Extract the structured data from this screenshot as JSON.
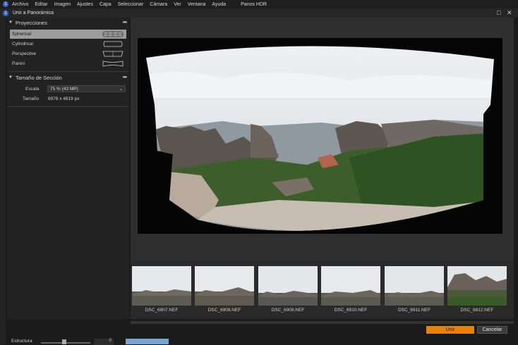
{
  "menubar": {
    "items": [
      "Archivo",
      "Editar",
      "Imagen",
      "Ajustes",
      "Capa",
      "Seleccionar",
      "Cámara",
      "Ver",
      "Ventana",
      "Ayuda",
      "Panos HDR"
    ]
  },
  "dialog": {
    "title": "Unir a Panorámica"
  },
  "projections": {
    "header": "Proyecciones",
    "items": [
      {
        "label": "Spherical",
        "icon": "spherical-projection-icon",
        "selected": true
      },
      {
        "label": "Cylindrical",
        "icon": "cylindrical-projection-icon",
        "selected": false
      },
      {
        "label": "Perspective",
        "icon": "perspective-projection-icon",
        "selected": false
      },
      {
        "label": "Panini",
        "icon": "panini-projection-icon",
        "selected": false
      }
    ]
  },
  "section_size": {
    "header": "Tamaño de Sección",
    "scale_label": "Escala",
    "scale_value": "75 % (43 MP)",
    "size_label": "Tamaño",
    "size_value": "8976 x 4819 px"
  },
  "thumbnails": [
    {
      "label": "DSC_6907.NEF"
    },
    {
      "label": "DSC_6908.NEF"
    },
    {
      "label": "DSC_6909.NEF"
    },
    {
      "label": "DSC_6910.NEF"
    },
    {
      "label": "DSC_6911.NEF"
    },
    {
      "label": "DSC_6912.NEF"
    }
  ],
  "buttons": {
    "accept": "Unir",
    "cancel": "Cancelar"
  },
  "bottom": {
    "label": "Estructura",
    "slider_value": "0",
    "slider_fraction": 0.43
  },
  "colors": {
    "accent": "#ee8000",
    "selected_row": "#9c9c9c"
  }
}
